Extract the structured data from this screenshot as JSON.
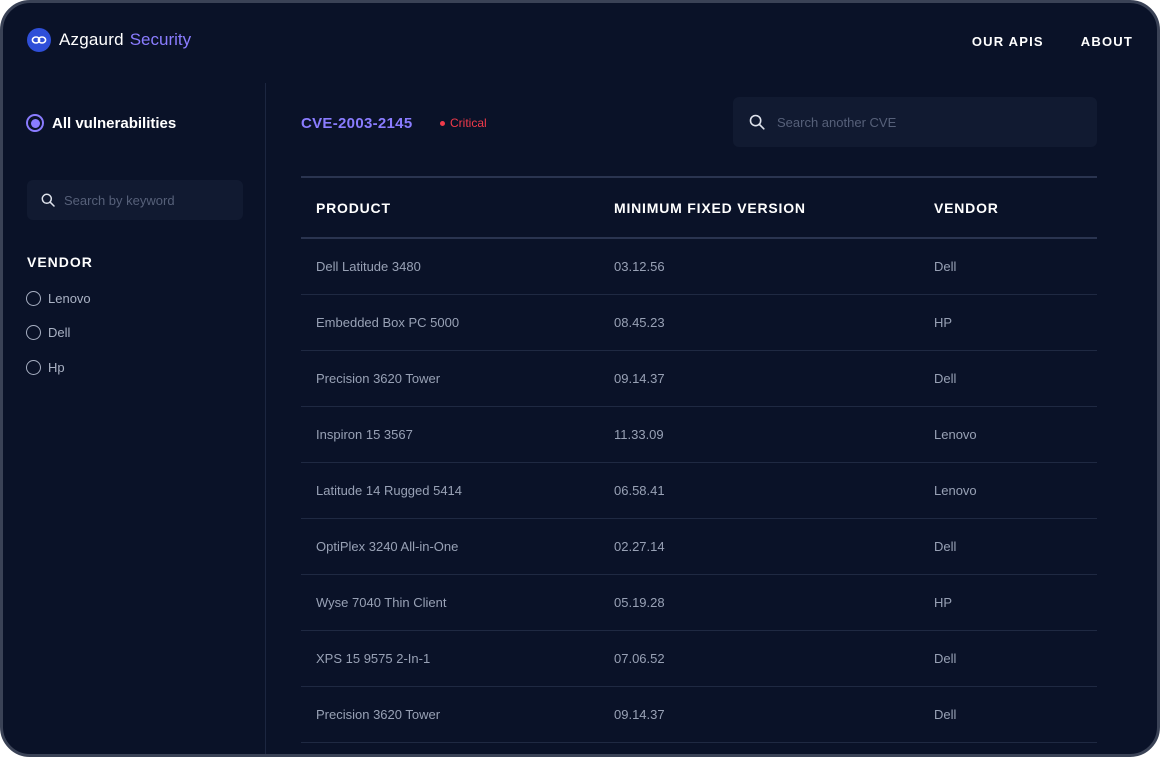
{
  "app": {
    "name": "Azgaurd",
    "suffix": "Security"
  },
  "nav": {
    "items": [
      "OUR APIS",
      "ABOUT"
    ]
  },
  "sidebar": {
    "all_label": "All vulnerabilities",
    "keyword_placeholder": "Search by keyword",
    "vendor_title": "VENDOR",
    "vendors": [
      "Lenovo",
      "Dell",
      "Hp"
    ]
  },
  "cve": {
    "id": "CVE-2003-2145",
    "severity": "Critical",
    "search_placeholder": "Search another CVE"
  },
  "table": {
    "headers": [
      "PRODUCT",
      "MINIMUM FIXED VERSION",
      "VENDOR"
    ],
    "rows": [
      [
        "Dell Latitude 3480",
        "03.12.56",
        "Dell"
      ],
      [
        "Embedded Box PC 5000",
        "08.45.23",
        "HP"
      ],
      [
        "Precision 3620 Tower",
        "09.14.37",
        "Dell"
      ],
      [
        "Inspiron 15 3567",
        "11.33.09",
        "Lenovo"
      ],
      [
        "Latitude 14 Rugged 5414",
        "06.58.41",
        "Lenovo"
      ],
      [
        "OptiPlex 3240 All-in-One",
        "02.27.14",
        "Dell"
      ],
      [
        "Wyse 7040 Thin Client",
        "05.19.28",
        "HP"
      ],
      [
        "XPS 15 9575 2-In-1",
        "07.06.52",
        "Dell"
      ],
      [
        "Precision 3620 Tower",
        "09.14.37",
        "Dell"
      ]
    ]
  },
  "colors": {
    "background": "#0a1228",
    "accent": "#8a7cff",
    "critical": "#f03a4a",
    "logo": "#2f4fd8"
  },
  "icons": {
    "logo": "infinity-link-icon",
    "search": "search-icon"
  }
}
